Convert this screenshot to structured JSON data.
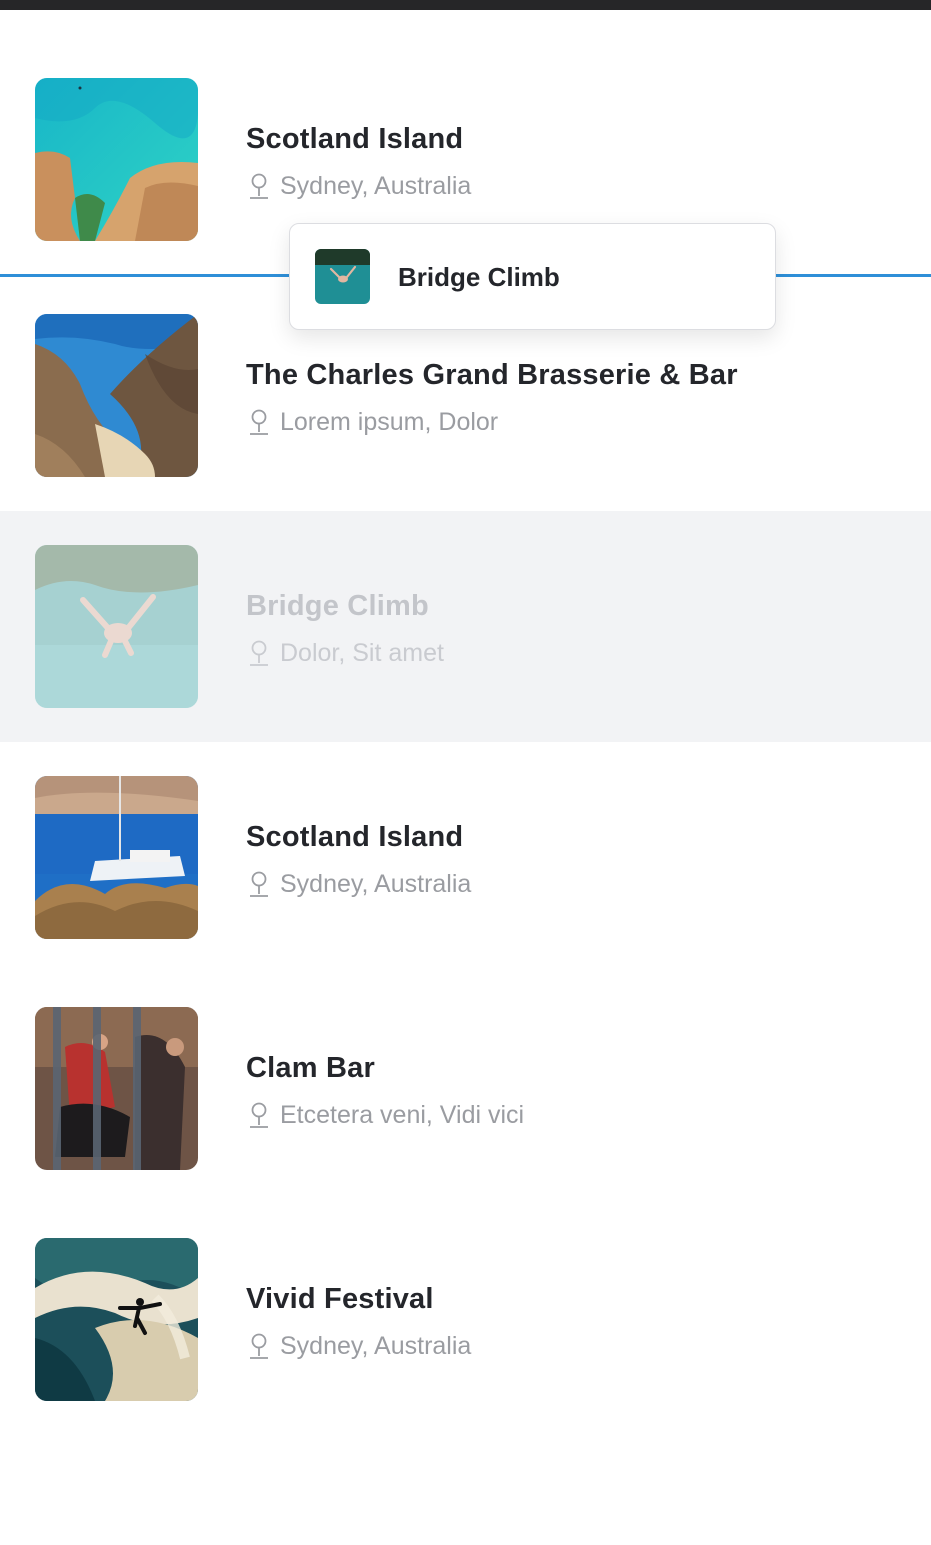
{
  "list": {
    "items": [
      {
        "title": "Scotland Island",
        "location": "Sydney, Australia",
        "image": "turquoise-cove-cliffs"
      },
      {
        "title": "The Charles Grand Brasserie & Bar",
        "location": "Lorem ipsum, Dolor",
        "image": "rocky-beach-bay"
      },
      {
        "title": "Bridge Climb",
        "location": "Dolor, Sit amet",
        "image": "diver-in-water",
        "state": "drag-placeholder"
      },
      {
        "title": "Scotland Island",
        "location": "Sydney, Australia",
        "image": "sailboat-harbor"
      },
      {
        "title": "Clam Bar",
        "location": "Etcetera veni, Vidi vici",
        "image": "street-dancers"
      },
      {
        "title": "Vivid Festival",
        "location": "Sydney, Australia",
        "image": "surfer-wave"
      }
    ]
  },
  "drag": {
    "title": "Bridge Climb",
    "image": "diver-in-water"
  },
  "icons": {
    "location": "map-pin-icon"
  },
  "colors": {
    "drop_indicator": "#2e8fd8",
    "placeholder_bg": "#f2f3f5",
    "title_text": "#24262b",
    "location_text": "#9a9ca1",
    "status_bar": "#262628"
  }
}
